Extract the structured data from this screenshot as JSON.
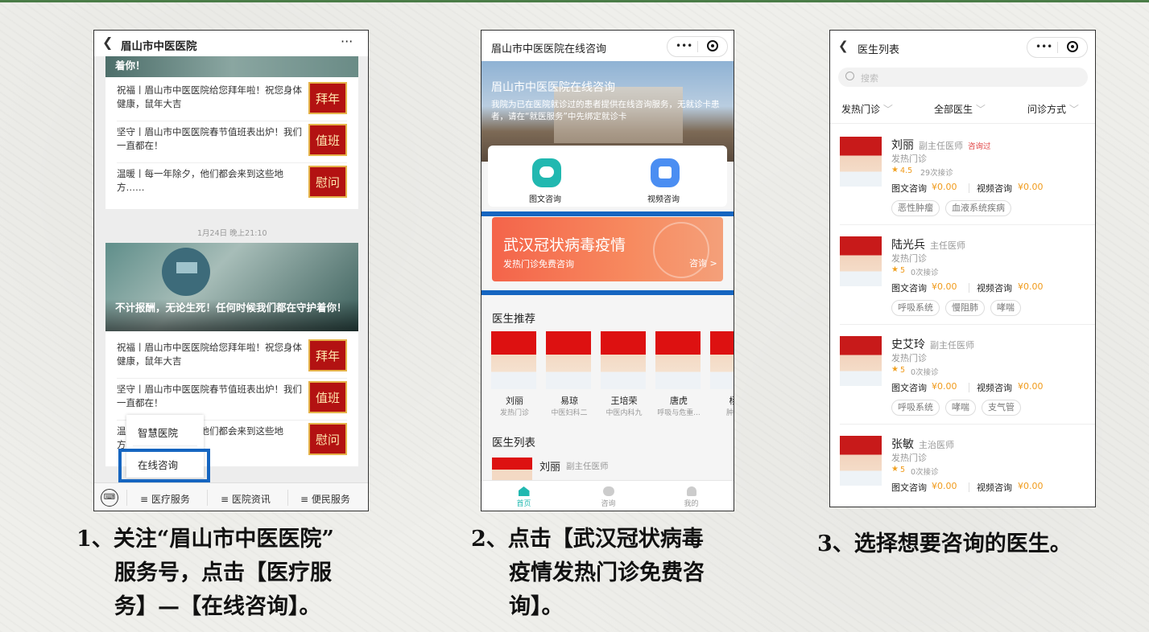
{
  "phone1": {
    "title": "眉山市中医医院",
    "more": "···",
    "top_card_tail": "着你！",
    "articles_a": [
      {
        "text": "祝福丨眉山市中医医院给您拜年啦！祝您身体健康，鼠年大吉",
        "badge": "拜年"
      },
      {
        "text": "坚守丨眉山市中医医院春节值班表出炉！我们一直都在！",
        "badge": "值班"
      },
      {
        "text": "温暖丨每一年除夕，他们都会来到这些地方……",
        "badge": "慰问"
      }
    ],
    "timestamp": "1月24日 晚上21:10",
    "card_caption": "不计报酬，无论生死！任何时候我们都在守护着你！",
    "articles_b": [
      {
        "text": "祝福丨眉山市中医医院给您拜年啦！祝您身体健康，鼠年大吉",
        "badge": "拜年"
      },
      {
        "text": "坚守丨眉山市中医医院春节值班表出炉！我们一直都在！",
        "badge": "值班"
      },
      {
        "text": "温暖丨每一年除夕，他们都会来到这些地方……",
        "badge": "慰问"
      }
    ],
    "popup": [
      "智慧医院",
      "在线咨询"
    ],
    "menu": [
      "≡ 医疗服务",
      "≡ 医院资讯",
      "≡ 便民服务"
    ]
  },
  "phone2": {
    "title": "眉山市中医医院在线咨询",
    "capsule_dots": "•••",
    "banner_title": "眉山市中医医院在线咨询",
    "banner_desc": "我院为已在医院就诊过的患者提供在线咨询服务，无就诊卡患者，请在“就医服务”中先绑定就诊卡",
    "services": [
      {
        "label": "图文咨询",
        "color": "#21b8b0"
      },
      {
        "label": "视频咨询",
        "color": "#4b8ef2"
      }
    ],
    "covid_title": "武汉冠状病毒疫情",
    "covid_sub": "发热门诊免费咨询",
    "covid_link": "咨询 >",
    "rec_heading": "医生推荐",
    "rec_doctors": [
      {
        "name": "刘丽",
        "dept": "发热门诊"
      },
      {
        "name": "易琼",
        "dept": "中医妇科二"
      },
      {
        "name": "王培荣",
        "dept": "中医内科九"
      },
      {
        "name": "唐虎",
        "dept": "呼吸与危重..."
      },
      {
        "name": "杨",
        "dept": "肿瘤"
      }
    ],
    "list_heading": "医生列表",
    "list_first": {
      "name": "刘丽",
      "title": "副主任医师",
      "dept": "发热门诊"
    },
    "tabs": [
      "首页",
      "咨询",
      "我的"
    ]
  },
  "phone3": {
    "title": "医生列表",
    "capsule_dots": "•••",
    "search_placeholder": "搜索",
    "filters": [
      "发热门诊",
      "全部医生",
      "问诊方式"
    ],
    "doctors": [
      {
        "name": "刘丽",
        "title": "副主任医师",
        "flag": "咨询过",
        "dept": "发热门诊",
        "rating": "4.5",
        "count": "29次接诊",
        "text_label": "图文咨询",
        "text_price": "¥0.00",
        "video_label": "视频咨询",
        "video_price": "¥0.00",
        "tags": [
          "恶性肿瘤",
          "血液系统疾病"
        ]
      },
      {
        "name": "陆光兵",
        "title": "主任医师",
        "flag": "",
        "dept": "发热门诊",
        "rating": "5",
        "count": "0次接诊",
        "text_label": "图文咨询",
        "text_price": "¥0.00",
        "video_label": "视频咨询",
        "video_price": "¥0.00",
        "tags": [
          "呼吸系统",
          "慢阻肺",
          "哮喘"
        ]
      },
      {
        "name": "史艾玲",
        "title": "副主任医师",
        "flag": "",
        "dept": "发热门诊",
        "rating": "5",
        "count": "0次接诊",
        "text_label": "图文咨询",
        "text_price": "¥0.00",
        "video_label": "视频咨询",
        "video_price": "¥0.00",
        "tags": [
          "呼吸系统",
          "哮喘",
          "支气管"
        ]
      },
      {
        "name": "张敏",
        "title": "主治医师",
        "flag": "",
        "dept": "发热门诊",
        "rating": "5",
        "count": "0次接诊",
        "text_label": "图文咨询",
        "text_price": "¥0.00",
        "video_label": "视频咨询",
        "video_price": "¥0.00",
        "tags": []
      }
    ]
  },
  "captions": {
    "step1": [
      "1、关注“眉山市中医医院”",
      "服务号，点击【医疗服",
      "务】—【在线咨询】。"
    ],
    "step2": [
      "2、点击【武汉冠状病毒",
      "疫情发热门诊免费咨",
      "询】。"
    ],
    "step3": [
      "3、选择想要咨询的医生。"
    ]
  },
  "colors": {
    "highlight": "#1565c0",
    "badge": "#b31212",
    "covid": "#f4644a",
    "price": "#f09a1a",
    "active_tab": "#21b8b0"
  }
}
